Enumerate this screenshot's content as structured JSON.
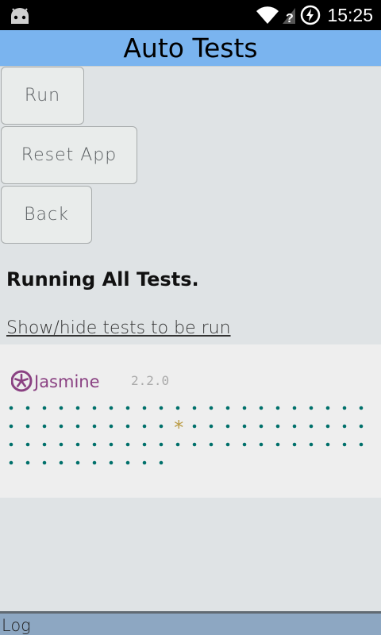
{
  "statusbar": {
    "time": "15:25",
    "icons": [
      "android-head-icon",
      "wifi-icon",
      "signal-no-sim-icon",
      "battery-charging-icon"
    ]
  },
  "header": {
    "title": "Auto Tests",
    "color": "#7ab4ef"
  },
  "buttons": {
    "run": "Run",
    "reset": "Reset App",
    "back": "Back"
  },
  "main": {
    "status": "Running All Tests.",
    "toggle_link": "Show/hide tests to be run"
  },
  "jasmine": {
    "brand": "Jasmine",
    "version": "2.2.0",
    "brand_color": "#8a4182",
    "passed_color": "#00706b",
    "pending_color": "#ba9b43",
    "rows": [
      "......................",
      "..........*...........",
      "......................",
      ".........."
    ]
  },
  "footer": {
    "label": "Log"
  }
}
